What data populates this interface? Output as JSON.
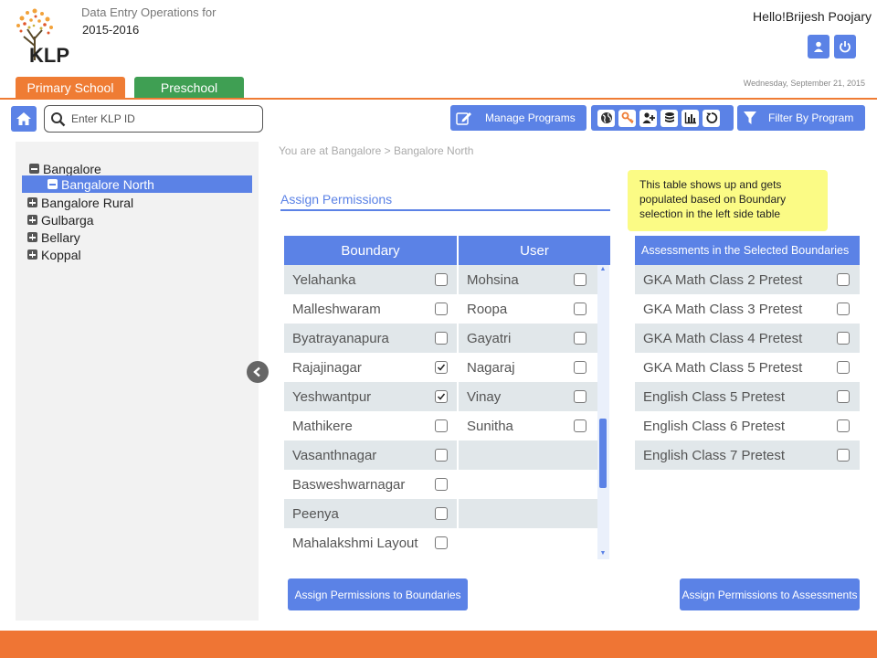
{
  "header": {
    "logo_text": "KLP",
    "subtitle": "Data Entry Operations for",
    "year": "2015-2016",
    "greeting_prefix": "Hello!",
    "user_name": "Brijesh Poojary",
    "date": "Wednesday, September 21, 2015"
  },
  "tabs": [
    {
      "label": "Primary School",
      "color": "#ef7c34"
    },
    {
      "label": "Preschool",
      "color": "#3f9f53"
    }
  ],
  "toolbar": {
    "search_placeholder": "Enter KLP ID",
    "manage_label": "Manage Programs",
    "filter_label": "Filter By Program",
    "icons": [
      "globe-icon",
      "key-icon",
      "add-user-icon",
      "database-icon",
      "bar-chart-icon",
      "refresh-icon"
    ]
  },
  "tree": {
    "root": "Bangalore",
    "selected": "Bangalore North",
    "others": [
      "Bangalore Rural",
      "Gulbarga",
      "Bellary",
      "Koppal"
    ]
  },
  "breadcrumb": "You are at Bangalore > Bangalore North",
  "section_title": "Assign Permissions",
  "note": "This table shows up and gets populated based on Boundary selection in the left side table",
  "boundary_table": {
    "header": "Boundary",
    "rows": [
      {
        "name": "Yelahanka",
        "checked": false
      },
      {
        "name": "Malleshwaram",
        "checked": false
      },
      {
        "name": "Byatrayanapura",
        "checked": false
      },
      {
        "name": "Rajajinagar",
        "checked": true
      },
      {
        "name": "Yeshwantpur",
        "checked": true
      },
      {
        "name": "Mathikere",
        "checked": false
      },
      {
        "name": "Vasanthnagar",
        "checked": false
      },
      {
        "name": "Basweshwarnagar",
        "checked": false
      },
      {
        "name": "Peenya",
        "checked": false
      },
      {
        "name": "Mahalakshmi Layout",
        "checked": false
      }
    ]
  },
  "user_table": {
    "header": "User",
    "rows": [
      {
        "name": "Mohsina",
        "checked": false
      },
      {
        "name": "Roopa",
        "checked": false
      },
      {
        "name": "Gayatri",
        "checked": false
      },
      {
        "name": "Nagaraj",
        "checked": false
      },
      {
        "name": "Vinay",
        "checked": false
      },
      {
        "name": "Sunitha",
        "checked": false
      }
    ]
  },
  "assessments": {
    "header": "Assessments in the Selected Boundaries",
    "rows": [
      {
        "name": "GKA Math Class 2 Pretest",
        "checked": false
      },
      {
        "name": "GKA Math Class 3 Pretest",
        "checked": false
      },
      {
        "name": "GKA Math Class 4 Pretest",
        "checked": false
      },
      {
        "name": "GKA Math Class 5 Pretest",
        "checked": false
      },
      {
        "name": "English Class 5 Pretest",
        "checked": false
      },
      {
        "name": "English Class 6 Pretest",
        "checked": false
      },
      {
        "name": "English Class 7 Pretest",
        "checked": false
      }
    ]
  },
  "buttons": {
    "assign_boundaries": "Assign Permissions to Boundaries",
    "assign_assessments": "Assign Permissions to Assessments"
  }
}
